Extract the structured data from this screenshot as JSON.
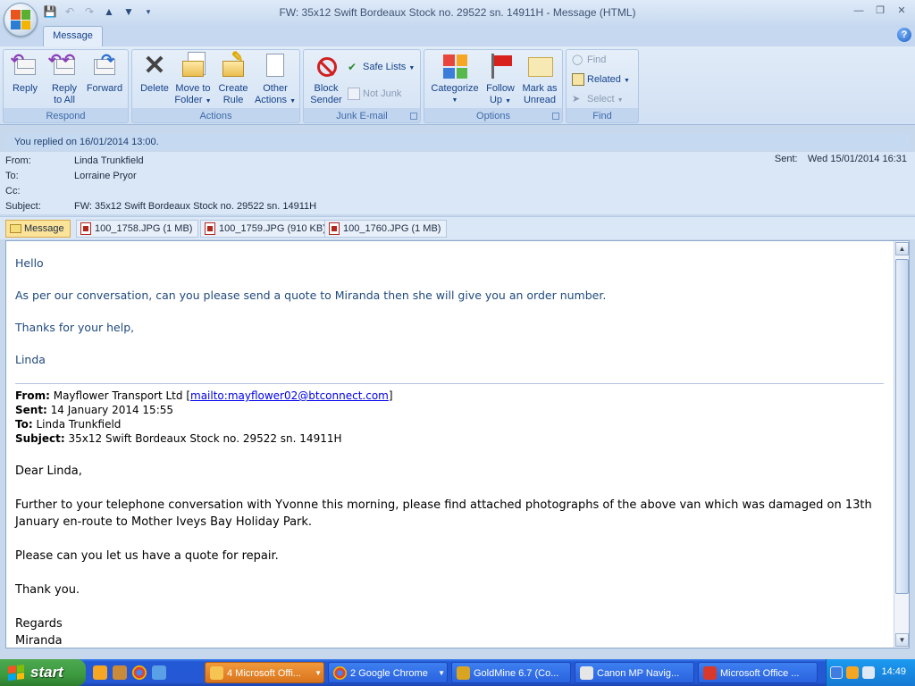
{
  "window": {
    "title": "FW: 35x12 Swift Bordeaux Stock no. 29522 sn. 14911H - Message (HTML)"
  },
  "ribbon": {
    "tab": "Message",
    "groups": {
      "respond": {
        "label": "Respond",
        "reply": "Reply",
        "reply_all_1": "Reply",
        "reply_all_2": "to All",
        "forward": "Forward"
      },
      "actions": {
        "label": "Actions",
        "delete": "Delete",
        "move_1": "Move to",
        "move_2": "Folder",
        "create_1": "Create",
        "create_2": "Rule",
        "other_1": "Other",
        "other_2": "Actions"
      },
      "junk": {
        "label": "Junk E-mail",
        "block_1": "Block",
        "block_2": "Sender",
        "safe_lists": "Safe Lists",
        "not_junk": "Not Junk"
      },
      "options": {
        "label": "Options",
        "categorize": "Categorize",
        "follow_1": "Follow",
        "follow_2": "Up",
        "mark_1": "Mark as",
        "mark_2": "Unread"
      },
      "find": {
        "label": "Find",
        "find": "Find",
        "related": "Related",
        "select": "Select"
      }
    }
  },
  "banner": "You replied on 16/01/2014 13:00.",
  "header": {
    "from_label": "From:",
    "from": "Linda Trunkfield",
    "to_label": "To:",
    "to": "Lorraine Pryor",
    "cc_label": "Cc:",
    "cc": "",
    "subject_label": "Subject:",
    "subject": "FW: 35x12 Swift Bordeaux Stock no. 29522 sn. 14911H",
    "sent_label": "Sent:",
    "sent": "Wed 15/01/2014 16:31"
  },
  "attachments": [
    {
      "name": "Message"
    },
    {
      "name": "100_1758.JPG (1 MB)"
    },
    {
      "name": "100_1759.JPG (910 KB)"
    },
    {
      "name": "100_1760.JPG (1 MB)"
    }
  ],
  "body": {
    "greeting": "Hello",
    "line1": "As per our conversation, can you please send a quote to Miranda then she will give you an order number.",
    "line2": "Thanks for your help,",
    "signoff": "Linda",
    "fwd": {
      "from_label": "From:",
      "from": " Mayflower Transport Ltd [",
      "from_link": "mailto:mayflower02@btconnect.com",
      "from_end": "]",
      "sent_label": "Sent:",
      "sent": " 14 January 2014 15:55",
      "to_label": "To:",
      "to": " Linda Trunkfield",
      "subject_label": "Subject:",
      "subject": " 35x12 Swift Bordeaux Stock no. 29522 sn. 14911H"
    },
    "dear": "Dear Linda,",
    "para1a": "Further to your telephone conversation with Yvonne this morning, please find attached photographs of the above van which was damaged on 13th",
    "para1b": "January en-route to Mother Iveys Bay Holiday Park.",
    "para2": "Please can you let us have a quote for repair.",
    "para3": "Thank you.",
    "regards": "Regards",
    "name": "Miranda"
  },
  "taskbar": {
    "start": "start",
    "tasks": [
      {
        "label": "4 Microsoft Offi..."
      },
      {
        "label": "2 Google Chrome"
      },
      {
        "label": "GoldMine 6.7 (Co..."
      },
      {
        "label": "Canon MP Navig..."
      },
      {
        "label": "Microsoft Office ..."
      }
    ],
    "clock": "14:49"
  },
  "colors": {
    "body_text_blue": "#1f497d",
    "link": "#0000ee",
    "taskbar": "#2458d4",
    "start": "#3c9a3e",
    "active_task": "#d9741c"
  }
}
